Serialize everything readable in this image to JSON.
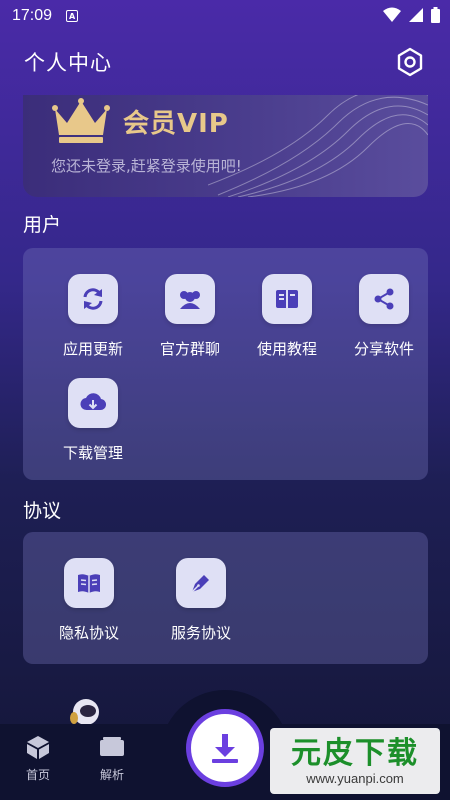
{
  "status": {
    "time": "17:09",
    "indicator": "A"
  },
  "header": {
    "title": "个人中心"
  },
  "vip": {
    "title": "会员VIP",
    "subtitle": "您还未登录,赶紧登录使用吧!"
  },
  "sections": {
    "user": {
      "title": "用户",
      "items": [
        {
          "label": "应用更新",
          "icon": "refresh-icon"
        },
        {
          "label": "官方群聊",
          "icon": "group-icon"
        },
        {
          "label": "使用教程",
          "icon": "book-icon"
        },
        {
          "label": "分享软件",
          "icon": "share-icon"
        },
        {
          "label": "下载管理",
          "icon": "cloud-download-icon"
        }
      ]
    },
    "agreement": {
      "title": "协议",
      "items": [
        {
          "label": "隐私协议",
          "icon": "privacy-book-icon"
        },
        {
          "label": "服务协议",
          "icon": "pen-icon"
        }
      ]
    }
  },
  "bottom_nav": {
    "home": "首页",
    "parse": "解析"
  },
  "watermark": {
    "title": "元皮下载",
    "url": "www.yuanpi.com"
  },
  "colors": {
    "accent": "#6b3fe0",
    "gold": "#e8c88a",
    "icon_fg": "#4b3fb8"
  }
}
